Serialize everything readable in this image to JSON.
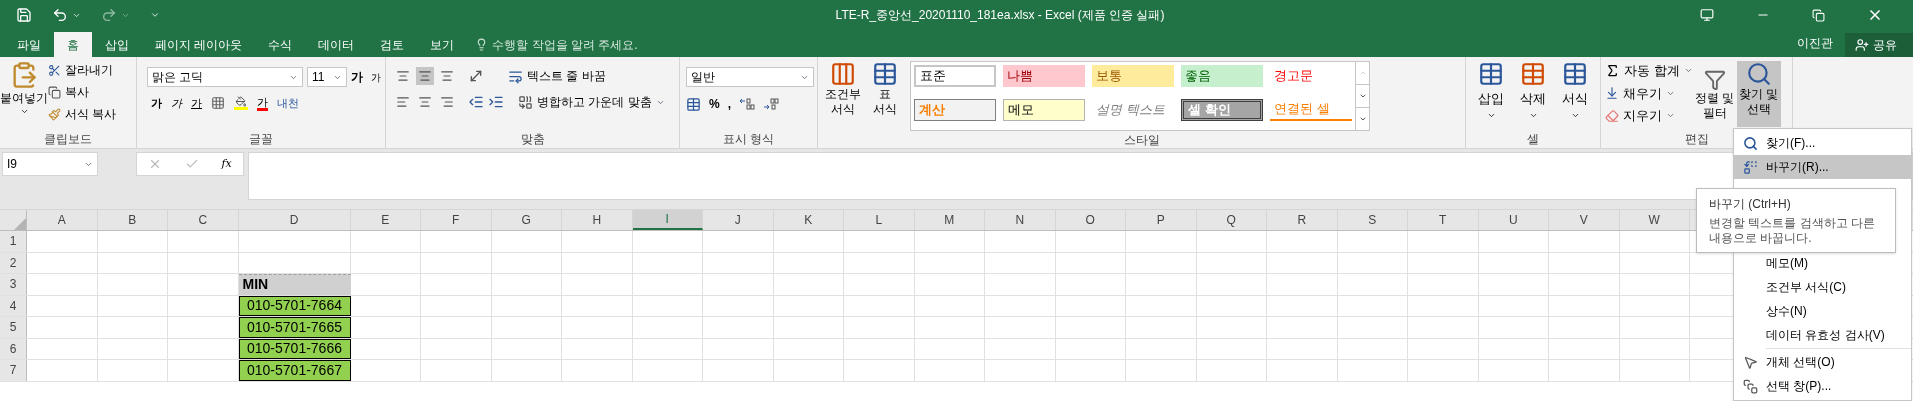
{
  "window": {
    "title": "LTE-R_중앙선_20201110_181ea.xlsx - Excel (제품 인증 실패)",
    "user": "이진관",
    "share": "공유"
  },
  "tabs": [
    {
      "label": "파일",
      "selected": false
    },
    {
      "label": "홈",
      "selected": true
    },
    {
      "label": "삽입",
      "selected": false
    },
    {
      "label": "페이지 레이아웃",
      "selected": false
    },
    {
      "label": "수식",
      "selected": false
    },
    {
      "label": "데이터",
      "selected": false
    },
    {
      "label": "검토",
      "selected": false
    },
    {
      "label": "보기",
      "selected": false
    }
  ],
  "tell_me": {
    "placeholder": "수행할 작업을 알려 주세요."
  },
  "ribbon": {
    "clipboard": {
      "label": "클립보드",
      "paste": "붙여넣기",
      "cut": "잘라내기",
      "copy": "복사",
      "format_painter": "서식 복사"
    },
    "font": {
      "label": "글꼴",
      "font_name": "맑은 고딕",
      "font_size": "11",
      "grow": "가",
      "shrink": "가",
      "bold": "가",
      "italic": "가",
      "underline": "가",
      "font_color": "가",
      "phonetic": "내천"
    },
    "alignment": {
      "label": "맞춤",
      "wrap_text": "텍스트 줄 바꿈",
      "merge_center": "병합하고 가운데 맞춤",
      "middle_align_selected": true
    },
    "number": {
      "label": "표시 형식",
      "format": "일반",
      "percent": "%",
      "comma": ","
    },
    "styles": {
      "label": "스타일",
      "conditional": [
        "조건부",
        "서식"
      ],
      "table": [
        "표",
        "서식"
      ],
      "gallery": [
        {
          "label": "표준",
          "kind": "normal"
        },
        {
          "label": "나쁨",
          "kind": "bad"
        },
        {
          "label": "보통",
          "kind": "neutral"
        },
        {
          "label": "좋음",
          "kind": "good"
        },
        {
          "label": "경고문",
          "kind": "warning"
        },
        {
          "label": "계산",
          "kind": "calculation"
        },
        {
          "label": "메모",
          "kind": "note"
        },
        {
          "label": "설명 텍스트",
          "kind": "explanatory"
        },
        {
          "label": "셀 확인",
          "kind": "check"
        },
        {
          "label": "연결된 셀",
          "kind": "linked"
        }
      ]
    },
    "cells": {
      "label": "셀",
      "insert": "삽입",
      "delete": "삭제",
      "format": "서식"
    },
    "editing": {
      "label": "편집",
      "autosum": "자동 합계",
      "fill": "채우기",
      "clear": "지우기",
      "sort_filter": [
        "정렬 및",
        "필터"
      ],
      "find_select": [
        "찾기 및",
        "선택"
      ],
      "find_select_pressed": true
    }
  },
  "formula_bar": {
    "name_box": "I9",
    "function_label": "fx"
  },
  "sheet": {
    "columns": [
      {
        "label": "A",
        "selected": false
      },
      {
        "label": "B",
        "selected": false
      },
      {
        "label": "C",
        "selected": false
      },
      {
        "label": "D",
        "selected": false,
        "wide": true
      },
      {
        "label": "E",
        "selected": false
      },
      {
        "label": "F",
        "selected": false
      },
      {
        "label": "G",
        "selected": false
      },
      {
        "label": "H",
        "selected": false
      },
      {
        "label": "I",
        "selected": true
      },
      {
        "label": "J",
        "selected": false
      },
      {
        "label": "K",
        "selected": false
      },
      {
        "label": "L",
        "selected": false
      },
      {
        "label": "M",
        "selected": false
      },
      {
        "label": "N",
        "selected": false
      },
      {
        "label": "O",
        "selected": false
      },
      {
        "label": "P",
        "selected": false
      },
      {
        "label": "Q",
        "selected": false
      },
      {
        "label": "R",
        "selected": false
      },
      {
        "label": "S",
        "selected": false
      },
      {
        "label": "T",
        "selected": false
      },
      {
        "label": "U",
        "selected": false
      },
      {
        "label": "V",
        "selected": false
      },
      {
        "label": "W",
        "selected": false
      }
    ],
    "rows": [
      {
        "label": "1"
      },
      {
        "label": "2"
      },
      {
        "label": "3",
        "d_cell": {
          "text": "MIN",
          "kind": "header"
        }
      },
      {
        "label": "4",
        "d_cell": {
          "text": "010-5701-7664",
          "kind": "good"
        }
      },
      {
        "label": "5",
        "d_cell": {
          "text": "010-5701-7665",
          "kind": "good"
        }
      },
      {
        "label": "6",
        "d_cell": {
          "text": "010-5701-7666",
          "kind": "good"
        }
      },
      {
        "label": "7",
        "d_cell": {
          "text": "010-5701-7667",
          "kind": "good"
        }
      }
    ]
  },
  "menu": {
    "items": [
      {
        "label": "찾기(F)...",
        "kind": "find",
        "selected": false,
        "divider": false
      },
      {
        "label": "바꾸기(R)...",
        "kind": "replace",
        "selected": true,
        "divider": false
      },
      {
        "kind": "hidden"
      },
      {
        "kind": "hidden"
      },
      {
        "kind": "hidden"
      },
      {
        "label": "메모(M)",
        "kind": "plain",
        "selected": false,
        "divider": false
      },
      {
        "label": "조건부 서식(C)",
        "kind": "plain",
        "selected": false,
        "divider": false
      },
      {
        "label": "상수(N)",
        "kind": "plain",
        "selected": false,
        "divider": false
      },
      {
        "label": "데이터 유효성 검사(V)",
        "kind": "plain",
        "selected": false,
        "divider": false
      },
      {
        "label": "개체 선택(O)",
        "kind": "pointer",
        "selected": false,
        "divider": true
      },
      {
        "label": "선택 창(P)...",
        "kind": "pane",
        "selected": false,
        "divider": false
      }
    ]
  },
  "tooltip": {
    "title": "바꾸기 (Ctrl+H)",
    "body": "변경할 텍스트를 검색하고 다른 내용으로 바꿉니다."
  }
}
